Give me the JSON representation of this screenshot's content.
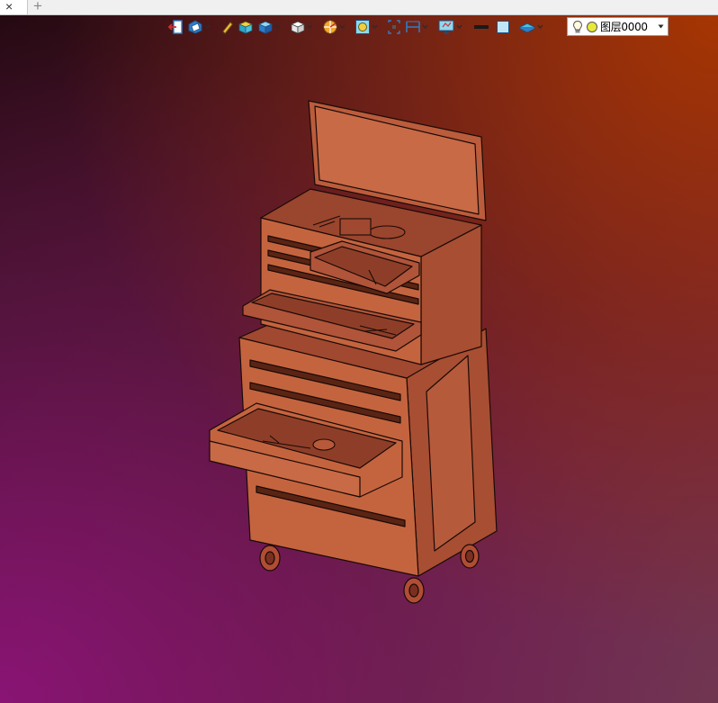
{
  "tabstrip": {
    "close_glyph": "×",
    "add_glyph": "+"
  },
  "toolbar": {
    "icons": [
      "exit-sketch-icon",
      "view-orientation-icon",
      "pencil-icon",
      "shaded-box-icon",
      "box-display-icon",
      "cube-view-icon",
      "section-view-icon",
      "zoom-fit-icon",
      "zoom-area-icon",
      "dimension-icon",
      "monitor-display-icon",
      "black-line-icon",
      "light-blue-square-icon",
      "plane-icon"
    ]
  },
  "layer": {
    "label": "图层0000",
    "bulb_icon": "lightbulb-icon",
    "dot_icon": "yellow-dot-icon"
  },
  "colors": {
    "model_face": "#b85a3a",
    "model_edge": "#1a0a06",
    "accent_blue": "#2e7ec8",
    "layer_dot": "#e8e83a"
  }
}
